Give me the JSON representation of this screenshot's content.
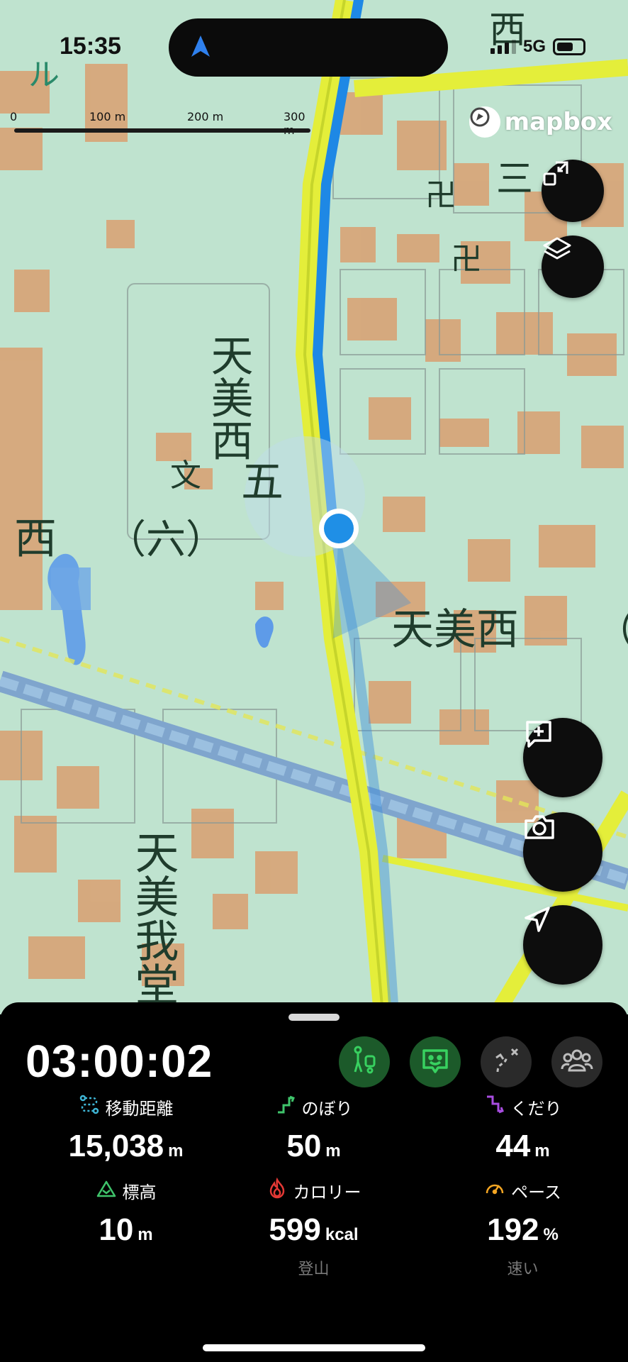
{
  "status_bar": {
    "time": "15:35",
    "network": "5G"
  },
  "map": {
    "scale": {
      "l0": "0",
      "l1": "100 m",
      "l2": "200 m",
      "l3": "300 m"
    },
    "attribution": "mapbox",
    "labels": {
      "a": "天美西",
      "b": "（五）",
      "c": "西",
      "d": "（六）",
      "e": "天美西",
      "f": "（",
      "g": "天美我堂",
      "h": "ル",
      "i": "西",
      "j": "三"
    }
  },
  "buttons": {
    "fit_icon": "collapse-icon",
    "layers_icon": "layers-icon",
    "memo_icon": "add-memo-icon",
    "camera_icon": "camera-icon",
    "locate_icon": "location-arrow-icon"
  },
  "panel": {
    "elapsed_time": "03:00:02",
    "modes": [
      "hiking",
      "memo",
      "route",
      "group"
    ],
    "stats": [
      {
        "label": "移動距離",
        "value": "15,038",
        "unit": "m",
        "sub": ""
      },
      {
        "label": "のぼり",
        "value": "50",
        "unit": "m",
        "sub": ""
      },
      {
        "label": "くだり",
        "value": "44",
        "unit": "m",
        "sub": ""
      },
      {
        "label": "標高",
        "value": "10",
        "unit": "m",
        "sub": ""
      },
      {
        "label": "カロリー",
        "value": "599",
        "unit": "kcal",
        "sub": "登山"
      },
      {
        "label": "ペース",
        "value": "192",
        "unit": "%",
        "sub": "速い"
      }
    ]
  },
  "colors": {
    "accent_green": "#1db954",
    "route_blue": "#1e88e5",
    "map_bg": "#bfe3cf",
    "road_yellow": "#e4ee3a"
  }
}
